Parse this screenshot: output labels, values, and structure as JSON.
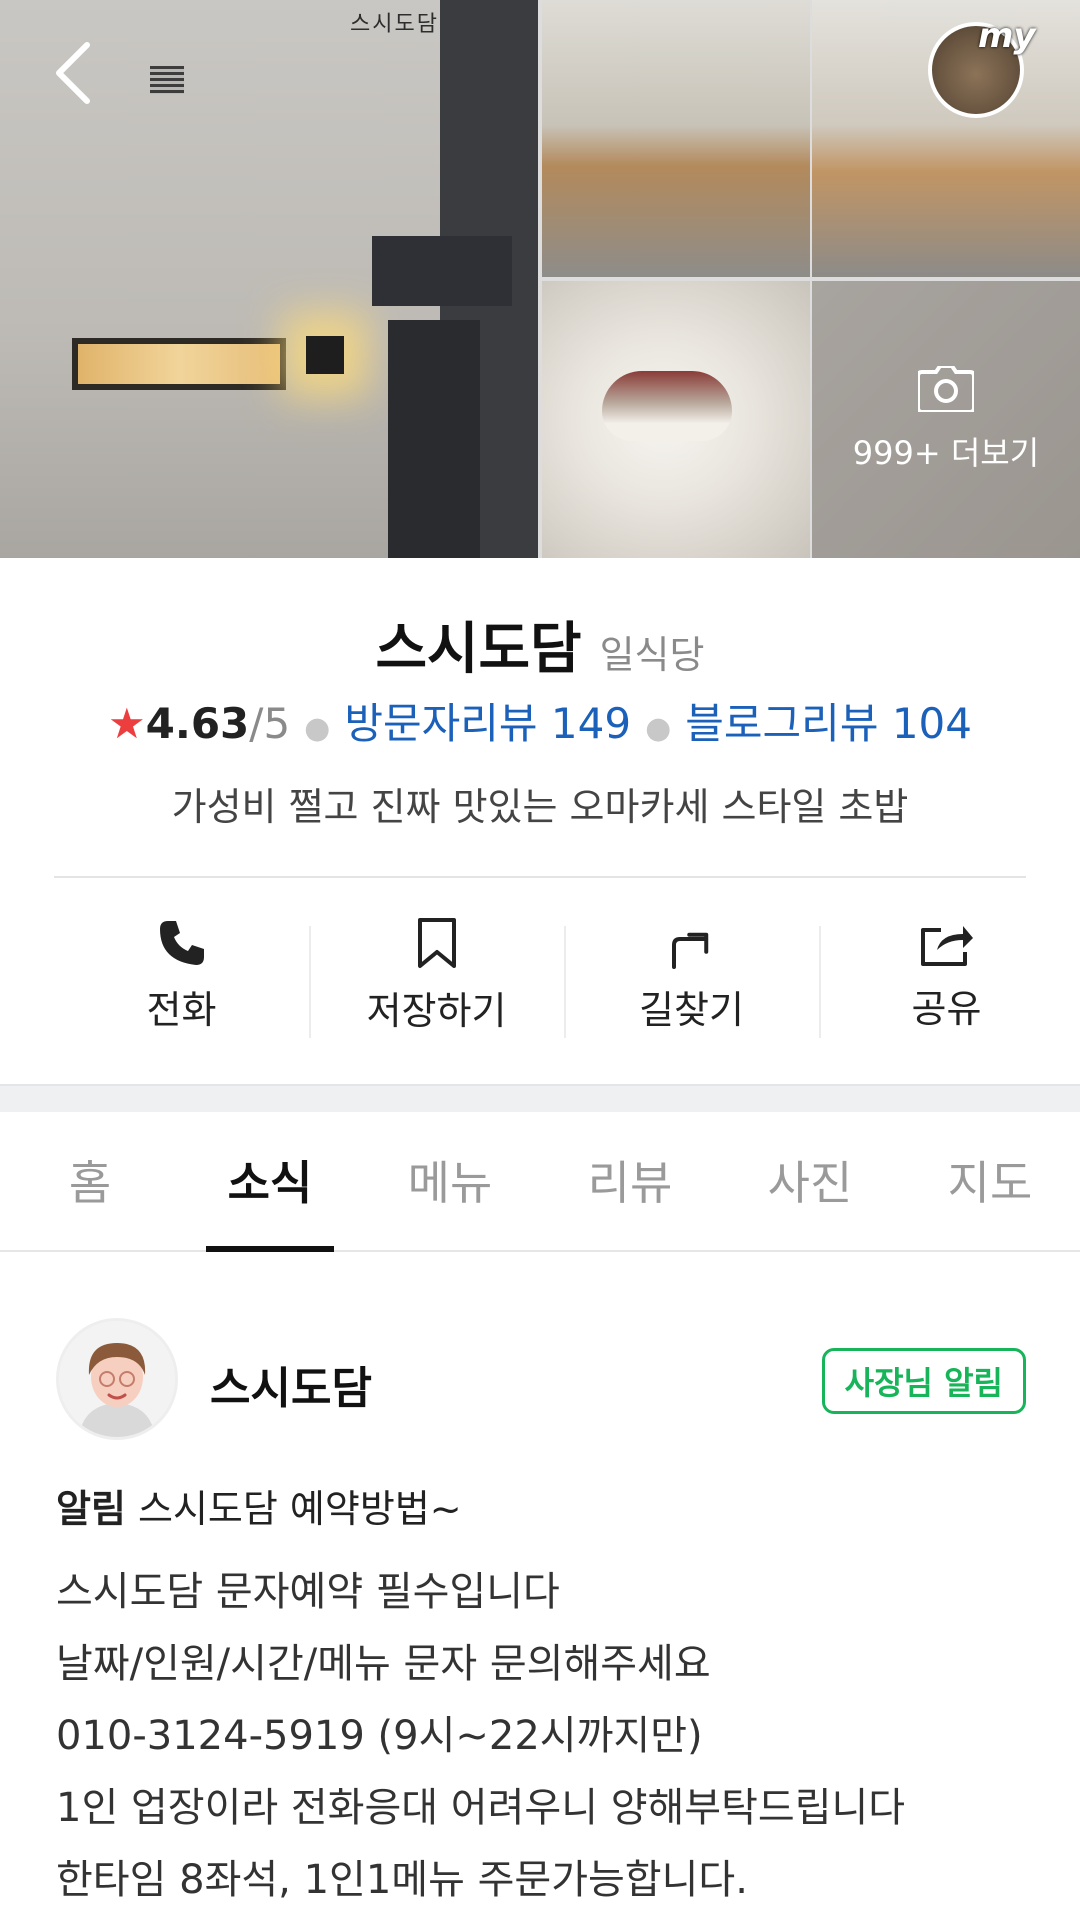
{
  "header": {
    "my_badge": "my",
    "gallery_more_label": "999+ 더보기",
    "storefront_sign": "스시도담"
  },
  "place": {
    "name": "스시도담",
    "category": "일식당",
    "rating_star": "★",
    "rating": "4.63",
    "rating_max": "/5",
    "visitor_reviews": "방문자리뷰 149",
    "blog_reviews": "블로그리뷰 104",
    "description": "가성비 쩔고 진짜 맛있는 오마카세 스타일 초밥"
  },
  "actions": [
    {
      "label": "전화",
      "icon": "phone-icon"
    },
    {
      "label": "저장하기",
      "icon": "bookmark-icon"
    },
    {
      "label": "길찾기",
      "icon": "directions-icon"
    },
    {
      "label": "공유",
      "icon": "share-icon"
    }
  ],
  "tabs": [
    {
      "label": "홈",
      "active": false
    },
    {
      "label": "소식",
      "active": true
    },
    {
      "label": "메뉴",
      "active": false
    },
    {
      "label": "리뷰",
      "active": false
    },
    {
      "label": "사진",
      "active": false
    },
    {
      "label": "지도",
      "active": false
    }
  ],
  "post": {
    "author": "스시도담",
    "badge": "사장님 알림",
    "title_prefix": "알림",
    "title": "스시도담 예약방법~",
    "lines": [
      "스시도담 문자예약 필수입니다",
      "날짜/인원/시간/메뉴 문자 문의해주세요",
      "010-3124-5919 (9시~22시까지만)",
      "1인 업장이라 전화응대 어려우니 양해부탁드립니다",
      "한타임 8좌석, 1인1메뉴 주문가능합니다."
    ]
  },
  "colors": {
    "link": "#1b60b9",
    "star": "#ec3e3e",
    "badge_green": "#18b45a"
  }
}
